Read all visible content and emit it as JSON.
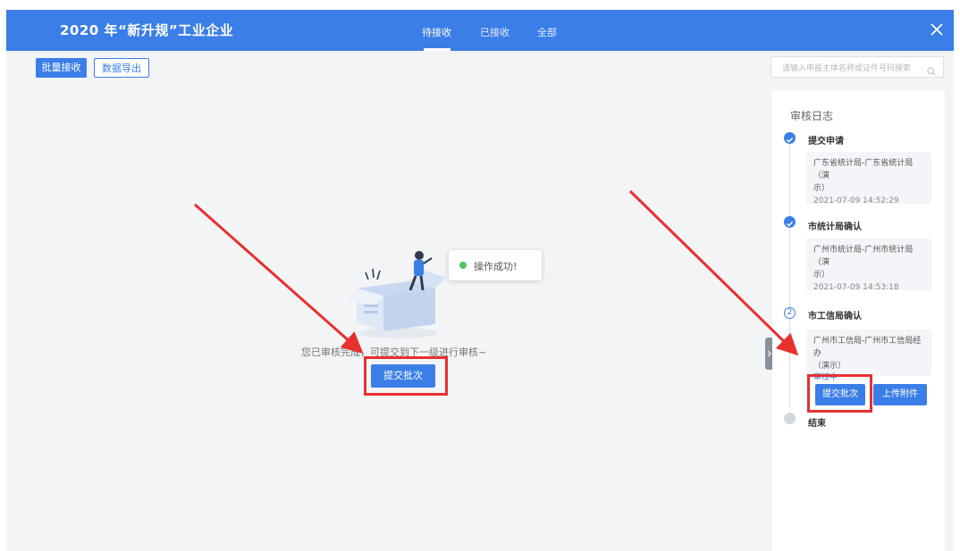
{
  "header": {
    "title": "2020 年“新升规”工业企业",
    "tabs": [
      {
        "label": "待接收",
        "active": true
      },
      {
        "label": "已接收",
        "active": false
      },
      {
        "label": "全部",
        "active": false
      }
    ]
  },
  "toolbar": {
    "batch_receive_label": "批量接收",
    "export_label": "数据导出"
  },
  "search": {
    "placeholder": "请输入申报主体名称或证件号码搜索"
  },
  "main": {
    "empty_message": "您已审核完成，可提交到下一级进行审核~",
    "submit_label": "提交批次",
    "toast_text": "操作成功!"
  },
  "log": {
    "title": "审核日志",
    "steps": [
      {
        "title": "提交申请",
        "line1": "广东省统计局-广东省统计局（演",
        "line2": "示）",
        "time": "2021-07-09 14:52:29"
      },
      {
        "title": "市统计局确认",
        "line1": "广州市统计局-广州市统计局（演",
        "line2": "示）",
        "time": "2021-07-09 14:53:18"
      },
      {
        "title": "市工信局确认",
        "step_no": "2",
        "line1": "广州市工信局-广州市工信局经办",
        "line2": "（演示）",
        "status": "审核中"
      },
      {
        "title": "结束"
      }
    ],
    "submit_label": "提交批次",
    "upload_label": "上传附件"
  },
  "colors": {
    "brand": "#3b7ee8",
    "annotation": "#e8302f",
    "success": "#4fc36a"
  }
}
